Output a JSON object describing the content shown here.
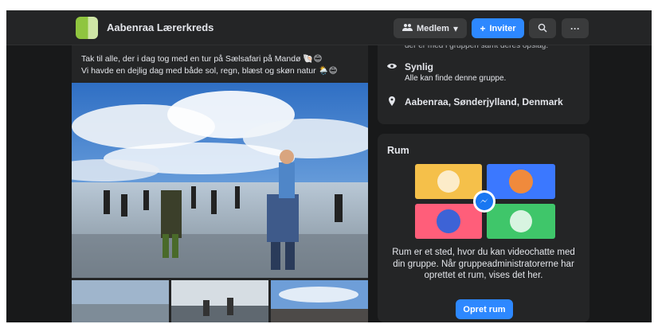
{
  "header": {
    "group_name": "Aabenraa Lærerkreds",
    "member_label": "Medlem",
    "invite_label": "Inviter"
  },
  "post": {
    "line1": "Tak til alle, der i dag tog med en tur på Sælsafari på Mandø 🐚😊",
    "line2": "Vi havde en dejlig dag med både sol, regn, blæst og skøn natur 🌦️😊"
  },
  "about": {
    "cut_text": "der er med i gruppen samt deres opslag.",
    "visibility_title": "Synlig",
    "visibility_sub": "Alle kan finde denne gruppe.",
    "location": "Aabenraa, Sønderjylland, Denmark"
  },
  "rooms": {
    "title": "Rum",
    "description": "Rum er et sted, hvor du kan videochatte med din gruppe. Når gruppeadministratorerne har oprettet et rum, vises det her.",
    "button_label": "Opret rum"
  },
  "colors": {
    "background": "#18191a",
    "card": "#242526",
    "accent": "#2d88ff"
  },
  "icons": [
    "group-thumbnail",
    "members-icon",
    "chevron-down-icon",
    "plus-icon",
    "search-icon",
    "more-icon",
    "eye-icon",
    "location-pin-icon",
    "messenger-icon"
  ]
}
